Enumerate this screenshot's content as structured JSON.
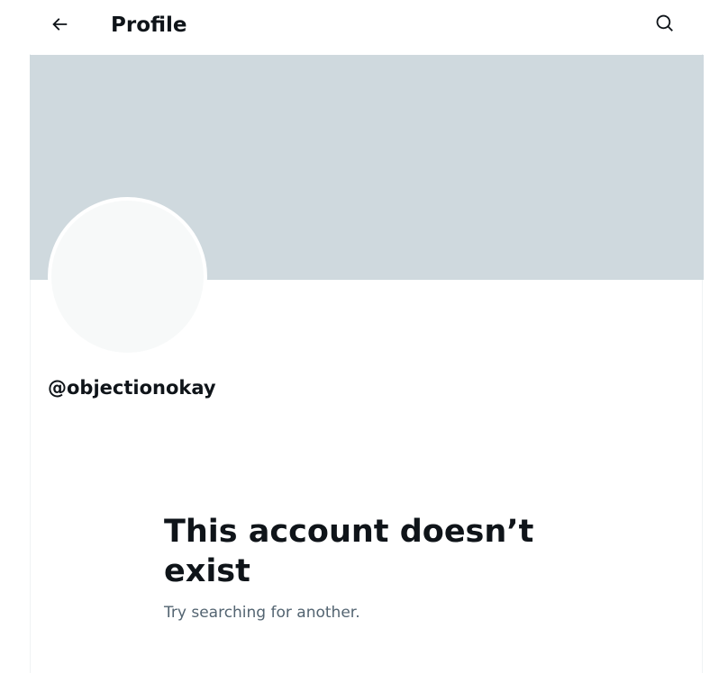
{
  "header": {
    "title": "Profile",
    "back_icon": "arrow-left-icon",
    "search_icon": "search-icon"
  },
  "profile": {
    "handle": "@objectionokay",
    "banner_color": "#cfd9de",
    "avatar_color": "#f7f9f9"
  },
  "empty_state": {
    "title": "This account doesn’t exist",
    "subtitle": "Try searching for another."
  },
  "colors": {
    "text_primary": "#0f1419",
    "text_secondary": "#536471",
    "border": "#eff3f4"
  }
}
